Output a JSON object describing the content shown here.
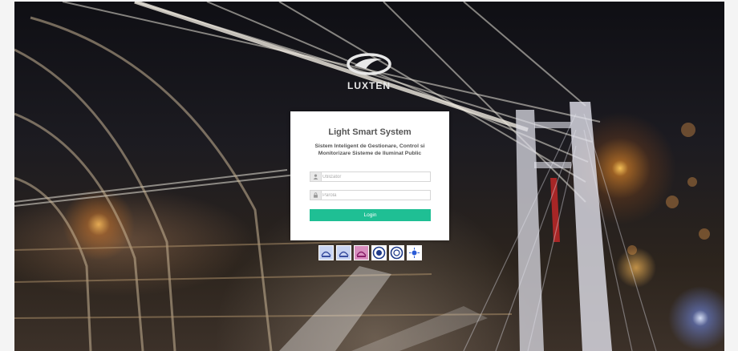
{
  "brand": {
    "logo_text": "LUXTEN"
  },
  "login_card": {
    "title": "Light Smart System",
    "subtitle_line1": "Sistem Inteligent de Gestionare, Control si",
    "subtitle_line2": "Monitorizare Sisteme de Iluminat Public",
    "username_placeholder": "Utilizator",
    "password_placeholder": "Parola",
    "login_label": "Login"
  },
  "certification_badges": [
    {
      "icon": "iso-certification-icon"
    },
    {
      "icon": "iso-certification-icon"
    },
    {
      "icon": "iso-certification-icon"
    },
    {
      "icon": "circular-seal-icon"
    },
    {
      "icon": "circular-seal-icon"
    },
    {
      "icon": "star-award-icon"
    }
  ],
  "colors": {
    "login_button": "#1fbf94",
    "card_background": "#ffffff",
    "text_primary": "#555555"
  }
}
